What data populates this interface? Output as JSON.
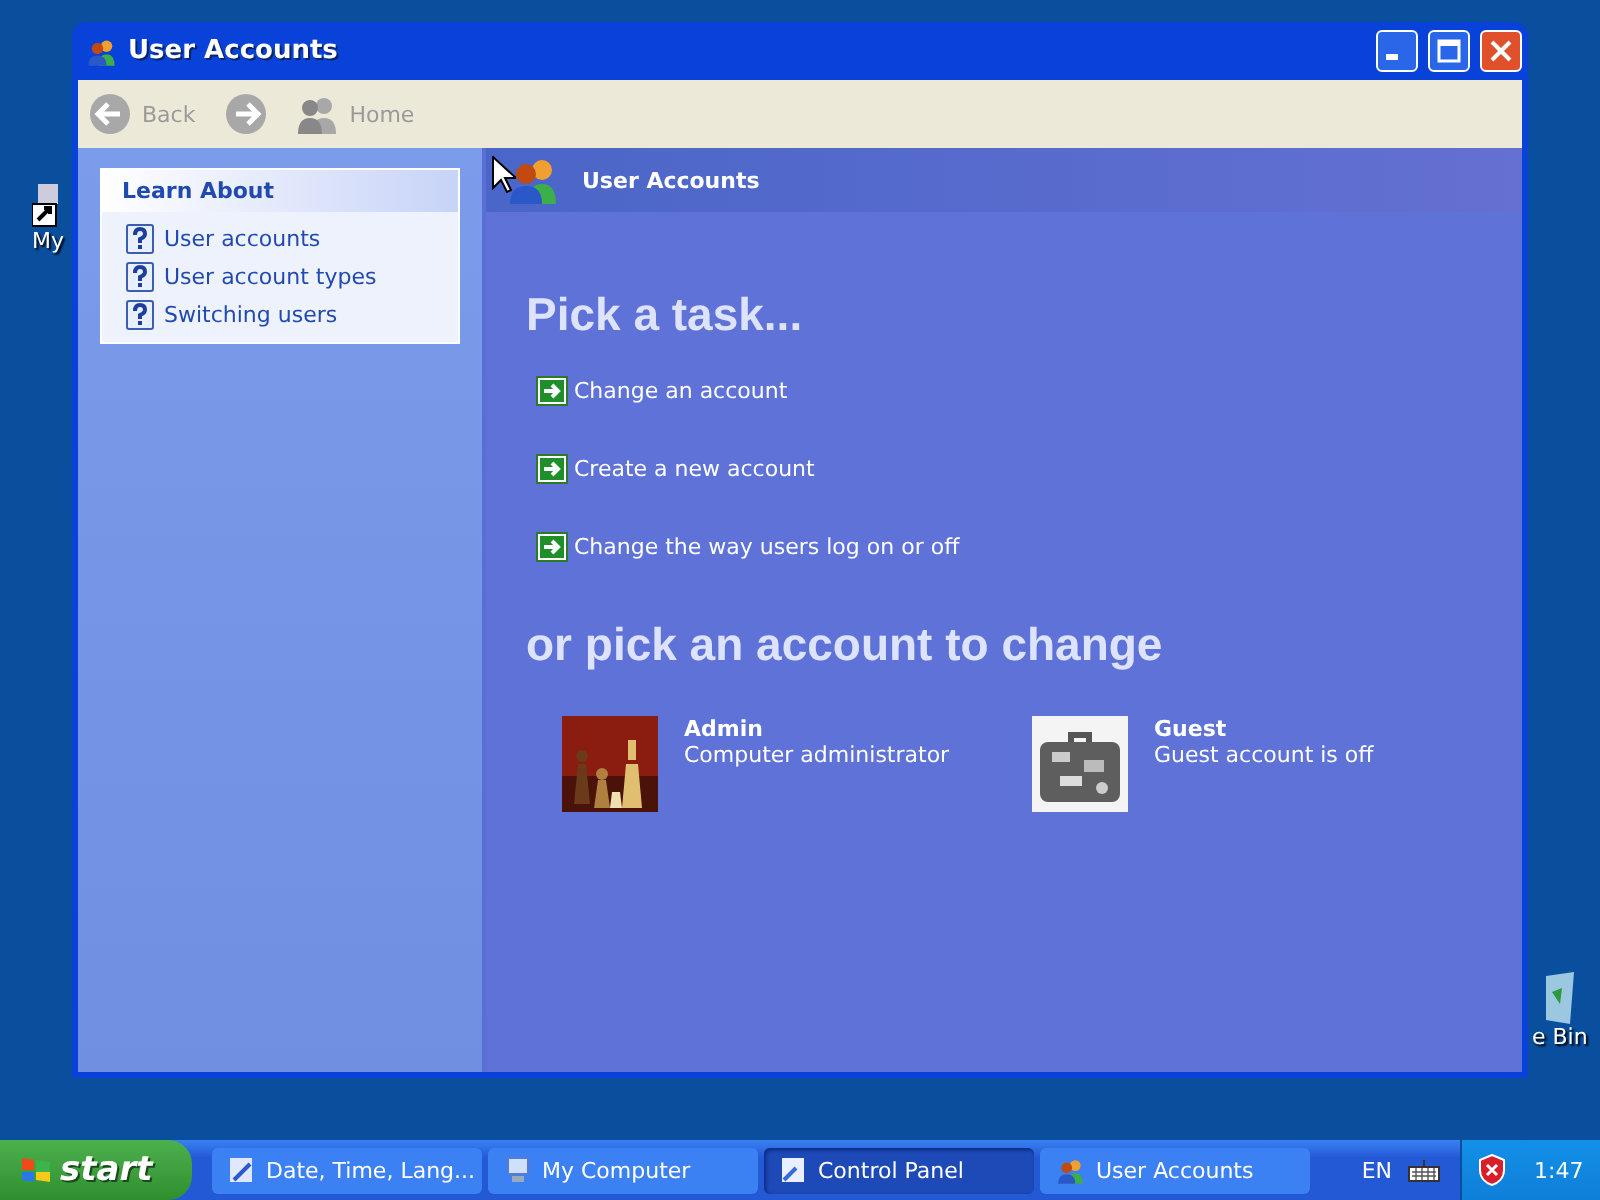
{
  "desktop_icons": [
    {
      "label": "My"
    },
    {
      "label": "e Bin"
    }
  ],
  "window": {
    "title": "User Accounts"
  },
  "toolbar": {
    "buttons": [
      {
        "label": "Back",
        "kind": "back",
        "disabled": true
      },
      {
        "kind": "forward",
        "disabled": true
      },
      {
        "label": "Home",
        "kind": "home",
        "disabled": true
      }
    ]
  },
  "learn_about": {
    "title": "Learn About",
    "items": [
      "User accounts",
      "User account types",
      "Switching users"
    ]
  },
  "header": {
    "title": "User Accounts"
  },
  "task_heading": "Pick a task...",
  "tasks": [
    "Change an account",
    "Create a new account",
    "Change the way users log on or off"
  ],
  "account_heading": "or pick an account to change",
  "accounts": [
    {
      "name": "Admin",
      "description": "Computer administrator"
    },
    {
      "name": "Guest",
      "description": "Guest account is off"
    }
  ],
  "taskbar": {
    "start": "start",
    "items": [
      {
        "label": "Date, Time, Lang...",
        "selected": false
      },
      {
        "label": "My Computer",
        "selected": false
      },
      {
        "label": "Control Panel",
        "selected": true
      },
      {
        "label": "User Accounts",
        "selected": false
      }
    ],
    "language": "EN",
    "clock": "1:47"
  }
}
